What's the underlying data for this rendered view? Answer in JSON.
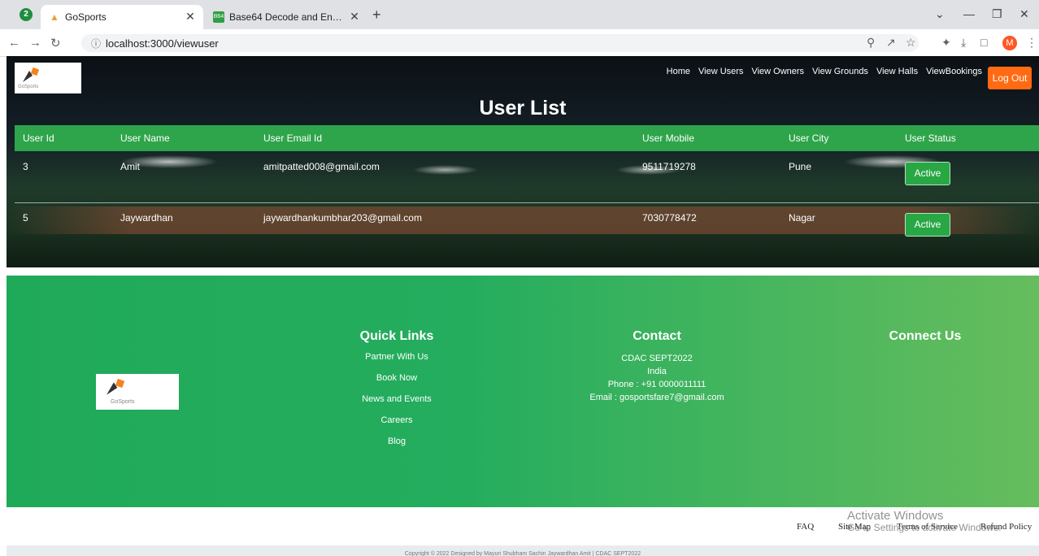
{
  "browser": {
    "tab_count_badge": "2",
    "tabs": [
      {
        "title": "GoSports",
        "active": true
      },
      {
        "title": "Base64 Decode and Encode - Onl",
        "active": false
      }
    ],
    "url": "localhost:3000/viewuser",
    "profile_initial": "M"
  },
  "nav": {
    "logo_text": "GoSports",
    "links": [
      "Home",
      "View Users",
      "View Owners",
      "View Grounds",
      "View Halls",
      "ViewBookings"
    ],
    "logout": "Log Out"
  },
  "page": {
    "title": "User List",
    "table": {
      "headers": [
        "User Id",
        "User Name",
        "User Email Id",
        "User Mobile",
        "User City",
        "User Status"
      ],
      "rows": [
        {
          "id": "3",
          "name": "Amit",
          "email": "amitpatted008@gmail.com",
          "mobile": "9511719278",
          "city": "Pune",
          "status": "Active"
        },
        {
          "id": "5",
          "name": "Jaywardhan",
          "email": "jaywardhankumbhar203@gmail.com",
          "mobile": "7030778472",
          "city": "Nagar",
          "status": "Active"
        }
      ]
    }
  },
  "footer": {
    "logo_text": "GoSports",
    "quick_links": {
      "title": "Quick Links",
      "items": [
        "Partner With Us",
        "Book Now",
        "News and Events",
        "Careers",
        "Blog"
      ]
    },
    "contact": {
      "title": "Contact",
      "lines": [
        "CDAC SEPT2022",
        "India",
        "Phone : +91 0000011111",
        "Email : gosportsfare7@gmail.com"
      ]
    },
    "connect": {
      "title": "Connect Us"
    },
    "bottom_links": [
      "FAQ",
      "Site Map",
      "Terms of Service",
      "Refund Policy"
    ],
    "copyright": "Copyright © 2022 Designed by Mayuri Shubham Sachin Jaywardhan Amit | CDAC SEPT2022"
  },
  "overlay": {
    "watermark_title": "Activate Windows",
    "watermark_sub": "Go to Settings to activate Windows."
  },
  "colors": {
    "header_green": "#2ea54a",
    "logout_orange": "#ff6a13",
    "status_green": "#28a745"
  }
}
